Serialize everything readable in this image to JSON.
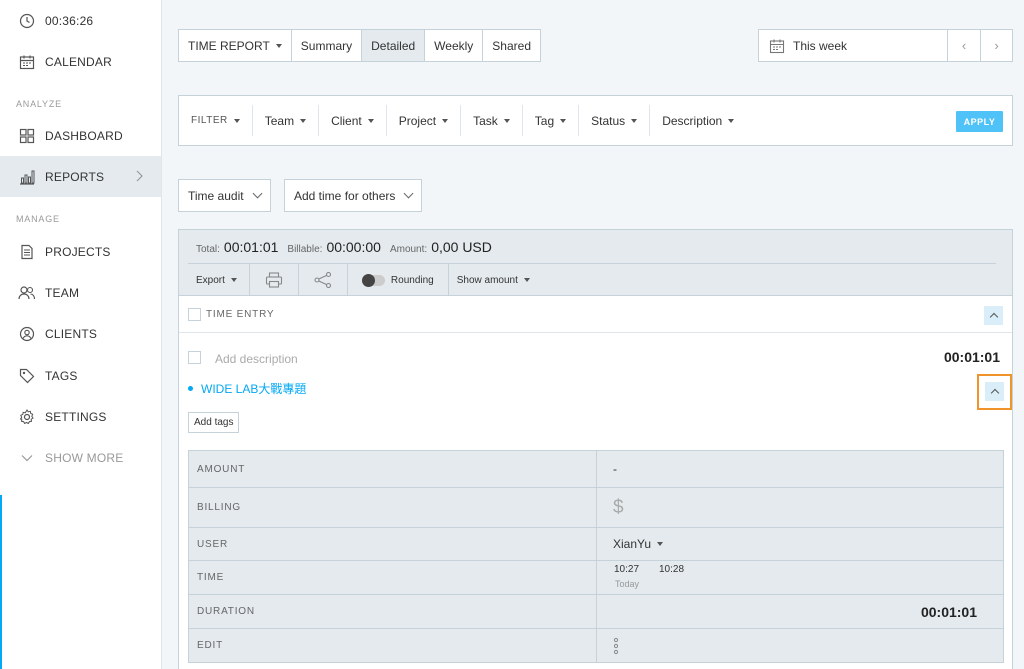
{
  "sidebar": {
    "timer": "00:36:26",
    "calendar": "CALENDAR",
    "analyze_label": "ANALYZE",
    "dashboard": "DASHBOARD",
    "reports": "REPORTS",
    "manage_label": "MANAGE",
    "projects": "PROJECTS",
    "team": "TEAM",
    "clients": "CLIENTS",
    "tags": "TAGS",
    "settings": "SETTINGS",
    "show_more": "SHOW MORE"
  },
  "toolbar": {
    "report_type": "TIME REPORT",
    "tabs": [
      "Summary",
      "Detailed",
      "Weekly",
      "Shared"
    ],
    "active_tab": "Detailed",
    "date_range": "This week"
  },
  "filters": {
    "items": [
      "FILTER",
      "Team",
      "Client",
      "Project",
      "Task",
      "Tag",
      "Status",
      "Description"
    ],
    "apply": "APPLY"
  },
  "dropdowns": {
    "time_audit": "Time audit",
    "add_time": "Add time for others"
  },
  "summary": {
    "total_label": "Total:",
    "total": "00:01:01",
    "billable_label": "Billable:",
    "billable": "00:00:00",
    "amount_label": "Amount:",
    "amount": "0,00 USD",
    "export": "Export",
    "rounding": "Rounding",
    "show_amount": "Show amount"
  },
  "table": {
    "header": "TIME ENTRY"
  },
  "entry": {
    "description_placeholder": "Add description",
    "duration": "00:01:01",
    "project": "WIDE LAB大戰專題",
    "add_tags": "Add tags",
    "details": {
      "amount_label": "AMOUNT",
      "amount": "-",
      "billing_label": "BILLING",
      "billing_symbol": "$",
      "user_label": "USER",
      "user": "XianYu",
      "time_label": "TIME",
      "time_start": "10:27",
      "time_end": "10:28",
      "time_day": "Today",
      "duration_label": "DURATION",
      "duration": "00:01:01",
      "edit_label": "EDIT"
    }
  },
  "colors": {
    "accent": "#03a9f4",
    "apply_button": "#4fc3f7",
    "highlight": "#f0932b"
  }
}
